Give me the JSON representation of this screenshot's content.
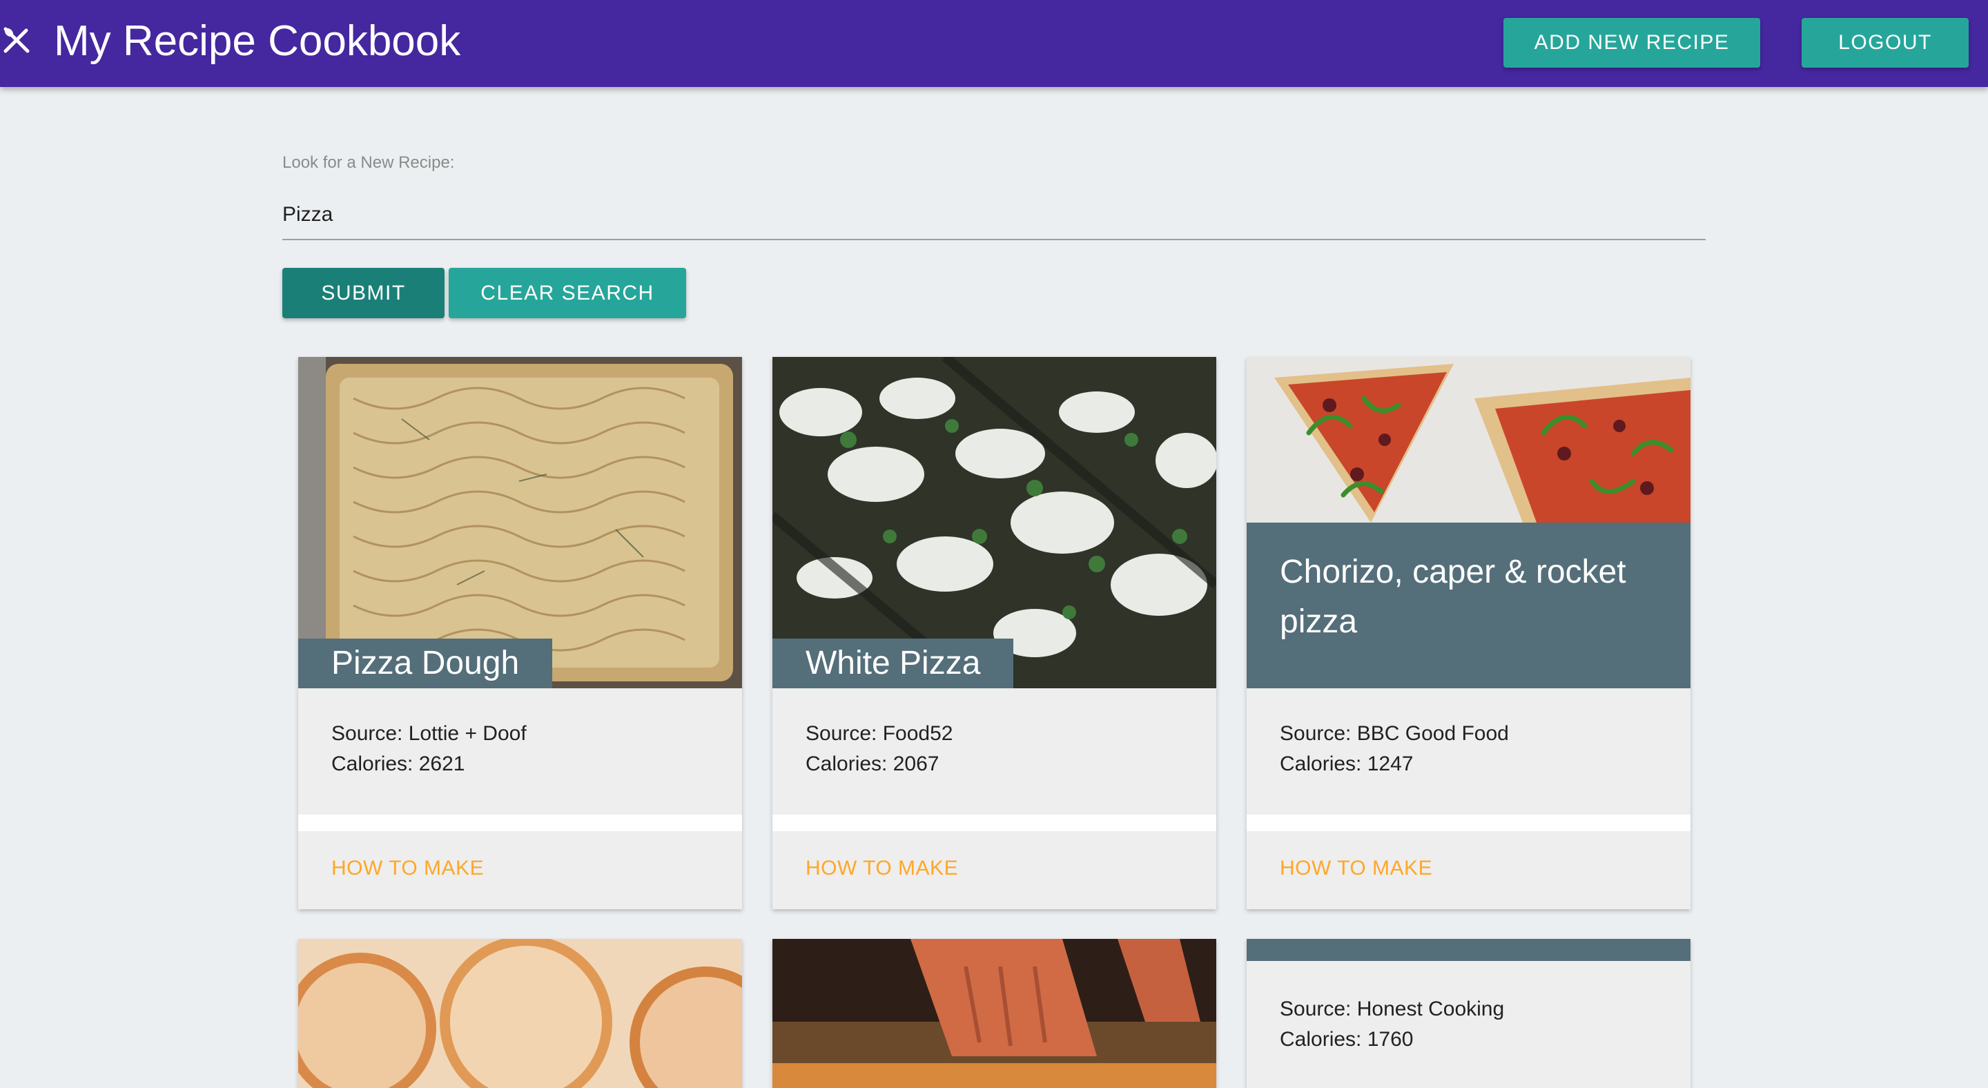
{
  "header": {
    "title": "My Recipe Cookbook",
    "logo_icon": "utensils-icon",
    "add_recipe_label": "ADD NEW RECIPE",
    "logout_label": "LOGOUT"
  },
  "search": {
    "label": "Look for a New Recipe:",
    "value": "Pizza",
    "submit_label": "SUBMIT",
    "clear_label": "CLEAR SEARCH"
  },
  "colors": {
    "appbar": "#4527a0",
    "button_teal": "#26a69a",
    "card_title_bg": "#546e7a",
    "link_orange": "#ffa726",
    "page_bg": "#eceff1"
  },
  "recipes": [
    {
      "title": "Pizza Dough",
      "source": "Source: Lottie + Doof",
      "calories": "Calories: 2621",
      "action": "HOW TO MAKE"
    },
    {
      "title": "White Pizza",
      "source": "Source: Food52",
      "calories": "Calories: 2067",
      "action": "HOW TO MAKE"
    },
    {
      "title": "Chorizo, caper & rocket pizza",
      "source": "Source: BBC Good Food",
      "calories": "Calories: 1247",
      "action": "HOW TO MAKE"
    },
    {
      "title": "",
      "source": "",
      "calories": ""
    },
    {
      "title": "",
      "source": "",
      "calories": ""
    },
    {
      "title": "",
      "source": "Source: Honest Cooking",
      "calories": "Calories: 1760"
    }
  ]
}
